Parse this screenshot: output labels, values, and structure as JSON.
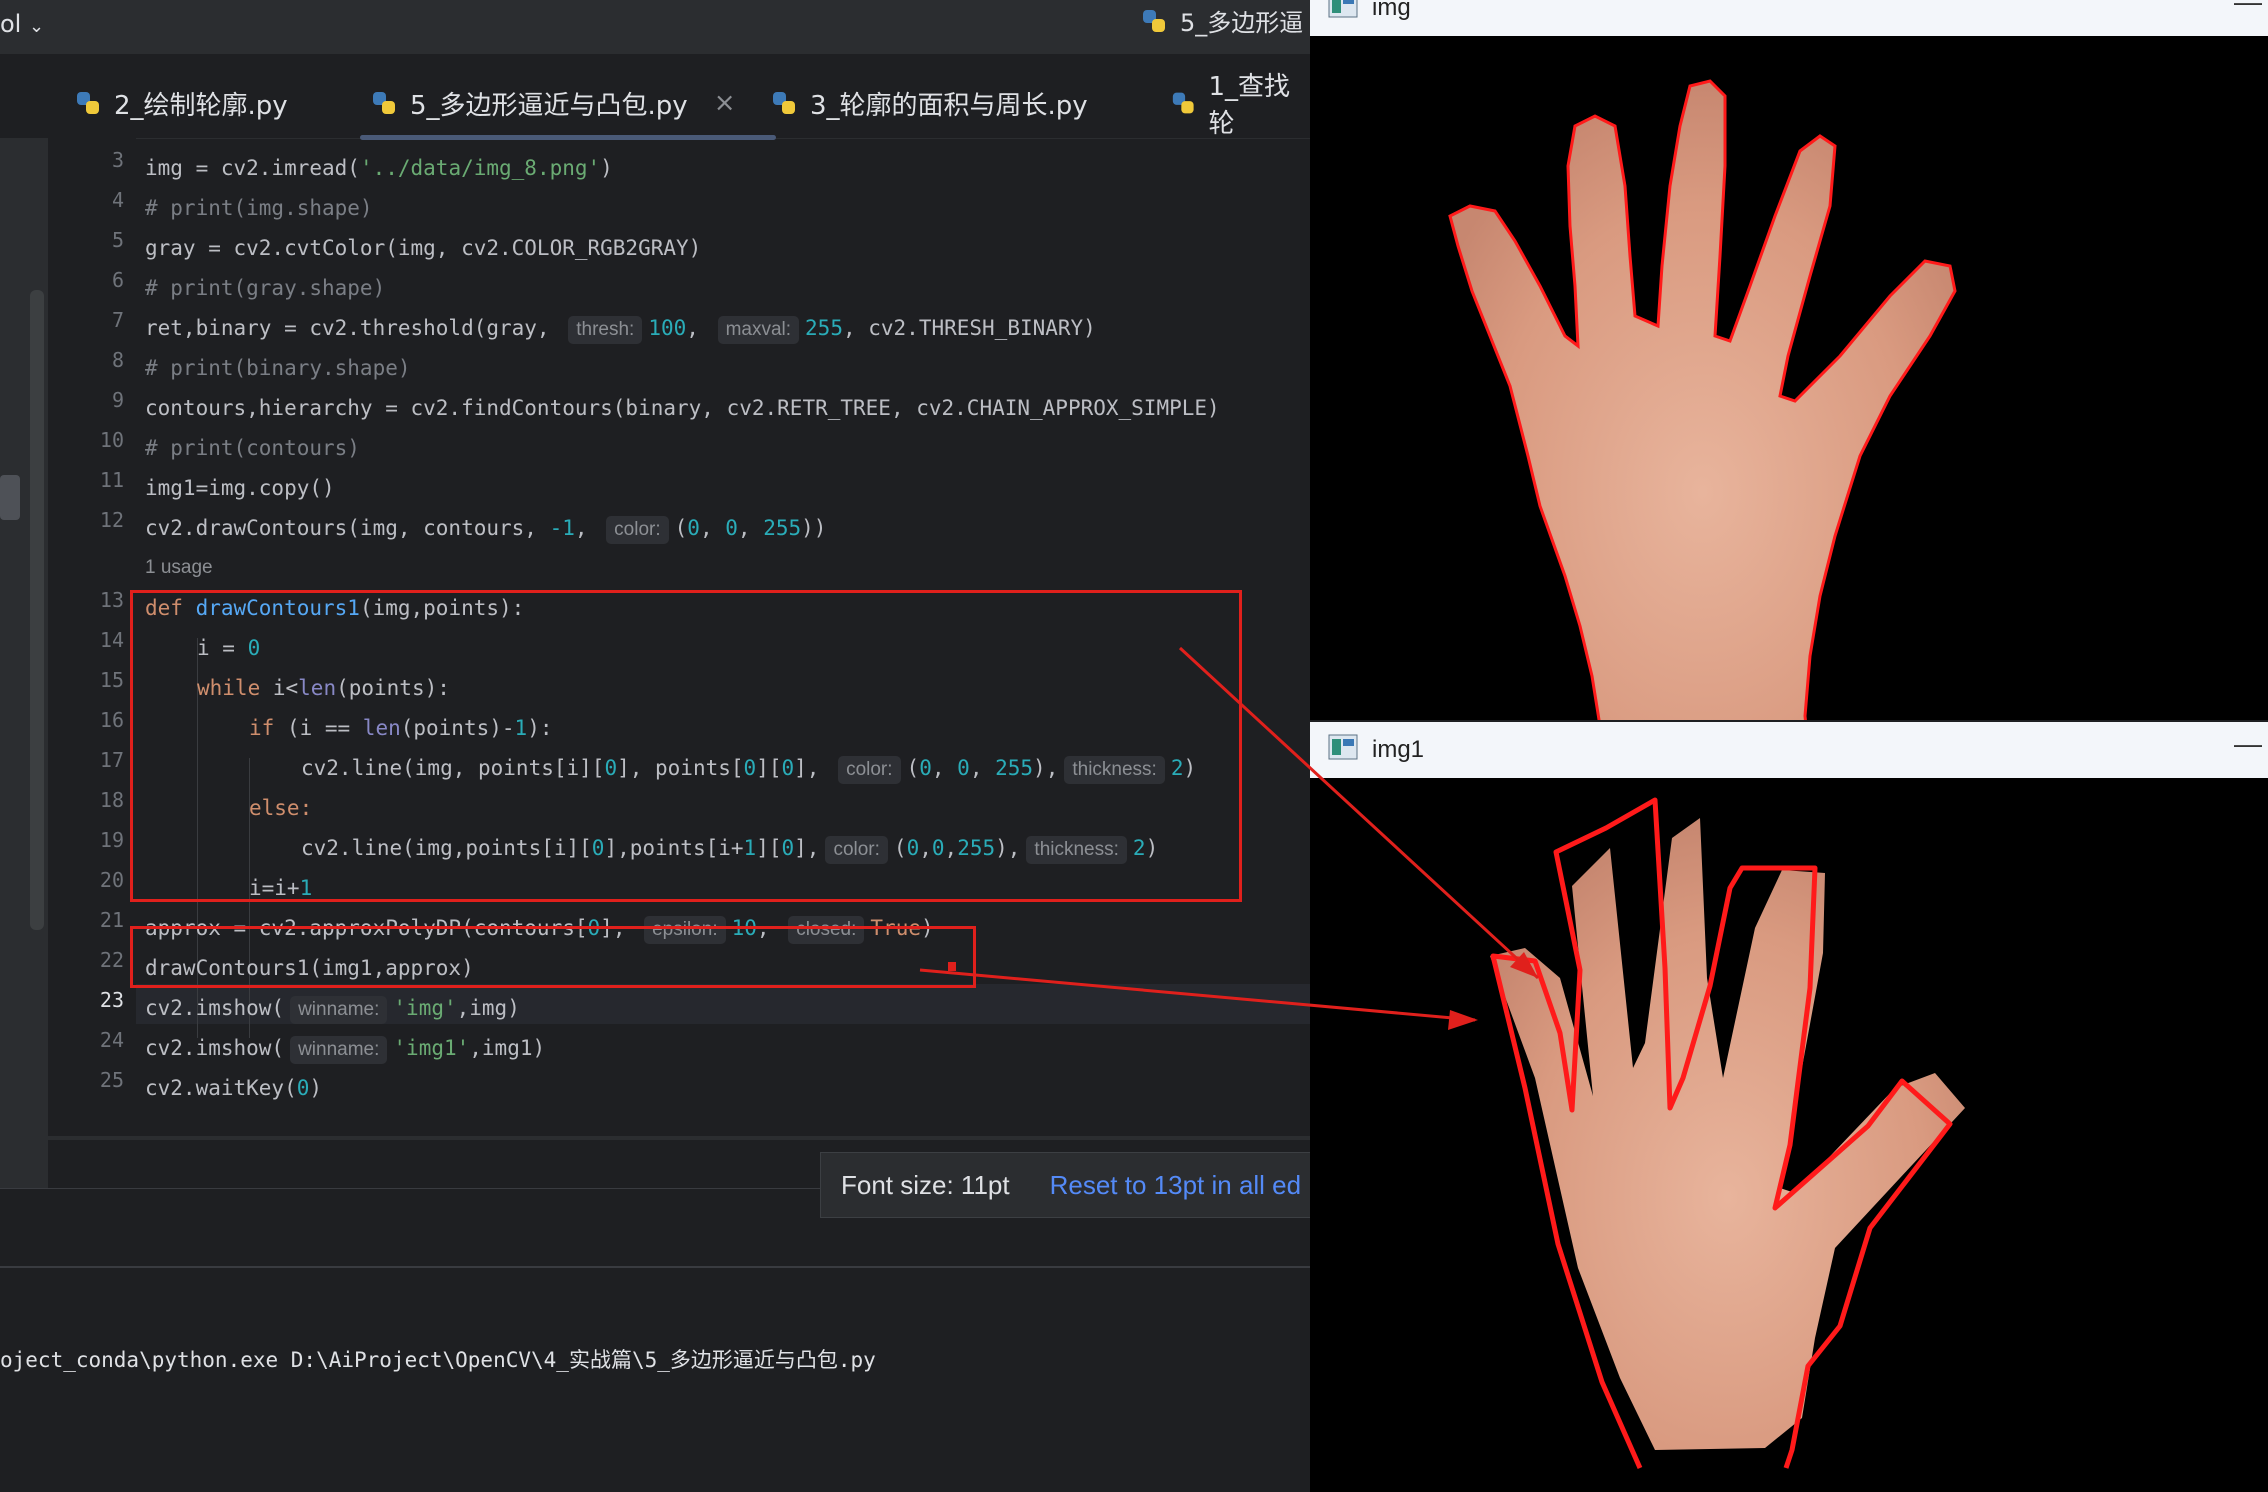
{
  "ide": {
    "project_name": "ol",
    "window_file_title": "5_多边形逼",
    "tabs": [
      {
        "label": "2_绘制轮廓.py"
      },
      {
        "label": "5_多边形逼近与凸包.py",
        "close": "×"
      },
      {
        "label": "3_轮廓的面积与周长.py"
      },
      {
        "label": "1_查找轮"
      }
    ],
    "line_numbers": [
      "3",
      "4",
      "5",
      "6",
      "7",
      "8",
      "9",
      "10",
      "11",
      "12",
      "13",
      "14",
      "15",
      "16",
      "17",
      "18",
      "19",
      "20",
      "21",
      "22",
      "23",
      "24",
      "25"
    ],
    "usage_hint": "1 usage",
    "hints": {
      "thresh": "thresh:",
      "maxval": "maxval:",
      "color": "color:",
      "thickness": "thickness:",
      "epsilon": "epsilon:",
      "closed": "closed:",
      "winname": "winname:"
    },
    "code": {
      "l3_a": "img = cv2.imread(",
      "l3_s": "'../data/img_8.png'",
      "l3_b": ")",
      "l4": "# print(img.shape)",
      "l5": "gray = cv2.cvtColor(img, cv2.COLOR_RGB2GRAY)",
      "l6": "# print(gray.shape)",
      "l7_a": "ret,binary = cv2.threshold(gray, ",
      "l7_n1": "100",
      "l7_b": ", ",
      "l7_n2": "255",
      "l7_c": ", cv2.THRESH_BINARY)",
      "l8": "# print(binary.shape)",
      "l9": "contours,hierarchy = cv2.findContours(binary, cv2.RETR_TREE, cv2.CHAIN_APPROX_SIMPLE)",
      "l10": "# print(contours)",
      "l11": "img1=img.copy()",
      "l12_a": "cv2.drawContours(img, contours, ",
      "l12_n": "-1",
      "l12_b": ", ",
      "l12_c": "(",
      "l12_n1": "0",
      "l12_d": ", ",
      "l12_n2": "0",
      "l12_e": ", ",
      "l12_n3": "255",
      "l12_f": "))",
      "l13_kw": "def ",
      "l13_fn": "drawContours1",
      "l13_b": "(img,points):",
      "l14_a": "i = ",
      "l14_n": "0",
      "l15_kw": "while ",
      "l15_a": "i<",
      "l15_bi": "len",
      "l15_b": "(points):",
      "l16_kw": "if ",
      "l16_a": "(i == ",
      "l16_bi": "len",
      "l16_b": "(points)-",
      "l16_n": "1",
      "l16_c": "):",
      "l17_a": "cv2.line(img, points[i][",
      "l17_n1": "0",
      "l17_b": "], points[",
      "l17_n2": "0",
      "l17_c": "][",
      "l17_n3": "0",
      "l17_d": "], ",
      "l17_e": "(",
      "l17_n4": "0",
      "l17_f": ", ",
      "l17_n5": "0",
      "l17_g": ", ",
      "l17_n6": "255",
      "l17_h": "),",
      "l17_n7": "2",
      "l17_i": ")",
      "l18_kw": "else:",
      "l19_a": "cv2.line(img,points[i][",
      "l19_n1": "0",
      "l19_b": "],points[i+",
      "l19_n2": "1",
      "l19_c": "][",
      "l19_n3": "0",
      "l19_d": "],",
      "l19_e": "(",
      "l19_n4": "0",
      "l19_f": ",",
      "l19_n5": "0",
      "l19_g": ",",
      "l19_n6": "255",
      "l19_h": "),",
      "l19_n7": "2",
      "l19_i": ")",
      "l20_a": "i=i+",
      "l20_n": "1",
      "l21_a": "approx = cv2.approxPolyDP(contours[",
      "l21_n1": "0",
      "l21_b": "], ",
      "l21_n2": "10",
      "l21_c": ", ",
      "l21_kw": "True",
      "l21_d": ")",
      "l22": "drawContours1(img1,approx)",
      "l23_a": "cv2.imshow(",
      "l23_s": "'img'",
      "l23_b": ",img)",
      "l24_a": "cv2.imshow(",
      "l24_s": "'img1'",
      "l24_b": ",img1)",
      "l25_a": "cv2.waitKey(",
      "l25_n": "0",
      "l25_b": ")"
    },
    "font_popup": {
      "label": "Font size: 11pt",
      "link": "Reset to 13pt in all ed"
    },
    "run_command": "oject_conda\\python.exe D:\\AiProject\\OpenCV\\4_实战篇\\5_多边形逼近与凸包.py"
  },
  "windows": [
    {
      "title": "img",
      "min": "—"
    },
    {
      "title": "img1",
      "min": "—"
    }
  ],
  "colors": {
    "annotation_red": "#e0201c",
    "contour_red": "#ff1a1a",
    "skin": "#e0a890"
  }
}
